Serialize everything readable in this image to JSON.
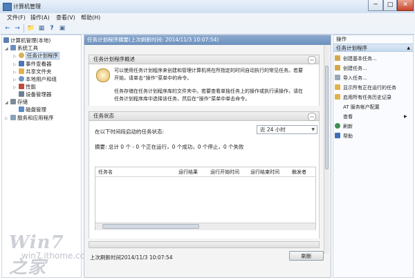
{
  "window": {
    "title": "计算机管理",
    "min": "─",
    "max": "□",
    "close": "✕"
  },
  "menu": [
    "文件(F)",
    "操作(A)",
    "查看(V)",
    "帮助(H)"
  ],
  "toolbar": [
    "←",
    "→",
    "📁",
    "▦",
    "?",
    "▣"
  ],
  "tree": [
    {
      "label": "计算机管理(本地)",
      "color": "#5b7fae"
    },
    {
      "label": "系统工具",
      "color": "#6d8fbf"
    },
    {
      "label": "任务计划程序",
      "color": "#d8b25a"
    },
    {
      "label": "事件查看器",
      "color": "#4c76b4"
    },
    {
      "label": "共享文件夹",
      "color": "#e1b24c"
    },
    {
      "label": "本地用户和组",
      "color": "#6b95c9"
    },
    {
      "label": "性能",
      "color": "#c04a3c"
    },
    {
      "label": "设备管理器",
      "color": "#6e7e93"
    },
    {
      "label": "存储",
      "color": "#7d8a9a"
    },
    {
      "label": "磁盘管理",
      "color": "#5f8bc2"
    },
    {
      "label": "服务和应用程序",
      "color": "#8aa0b8"
    }
  ],
  "center": {
    "header": "任务计划程序摘要(上次刷新时间: 2014/11/3 10:07:54)",
    "overview_title": "任务计划程序概述",
    "overview_p1_l1": "可以使用任务计划程序来创建和管理计算机将在所指定的时间自动执行的常见任务。若要",
    "overview_p1_l2": "开始，请单击“操作”菜单中的命令。",
    "overview_p2_l1": "任务存储在任务计划程序库的文件夹中。若要查看单独任务上的操作或执行读操作，请在",
    "overview_p2_l2": "任务计划程序库中选择该任务，然后在“操作”菜单中单击命令。",
    "status_title": "任务状态",
    "status_prompt": "在以下时间段启动的任务状态:",
    "status_period": "近 24 小时",
    "summary": "摘要: 总计 0 个 - 0 个正在运行，0 个成功，0 个停止，0 个失败",
    "columns": [
      "任务名",
      "运行结果",
      "运行开始时间",
      "运行结束时间",
      "触发者"
    ],
    "last_refresh": "上次刷新时间2014/11/3 10:07:54",
    "refresh_button": "刷新"
  },
  "actions": {
    "header": "操作",
    "subheader": "任务计划程序",
    "items": [
      {
        "label": "创建基本任务...",
        "color": "#d4a84a"
      },
      {
        "label": "创建任务...",
        "color": "#d4a84a"
      },
      {
        "label": "导入任务...",
        "color": "#9aa8b8"
      },
      {
        "label": "显示所有正在运行的任务",
        "color": "#e2b24a"
      },
      {
        "label": "启用所有任务历史记录",
        "color": "#e2b24a"
      },
      {
        "label": "AT 服务帐户配置",
        "color": ""
      },
      {
        "label": "查看",
        "color": ""
      },
      {
        "label": "刷新",
        "color": "#3f8f4f"
      },
      {
        "label": "帮助",
        "color": "#3d6fb8"
      }
    ]
  },
  "watermark": {
    "brand": "Win7之家",
    "url": "win7.ithome.com"
  }
}
